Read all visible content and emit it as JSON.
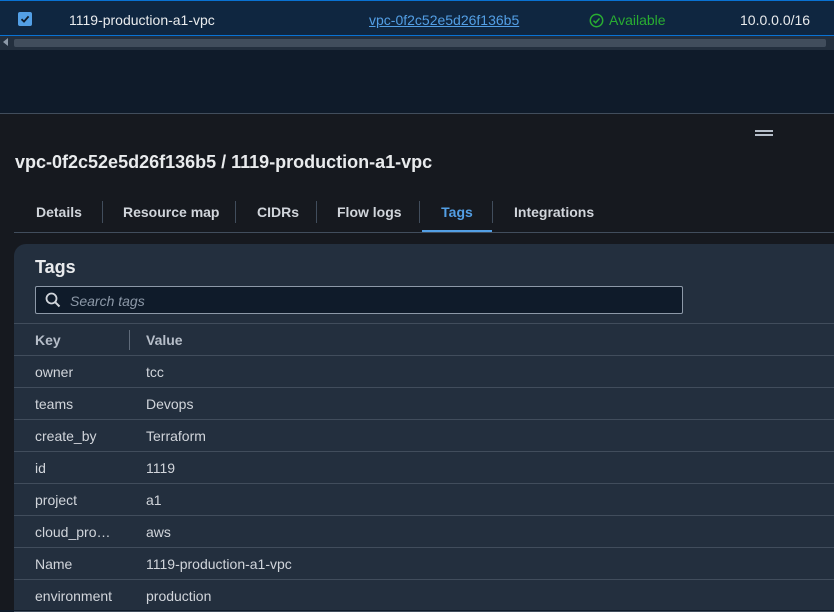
{
  "top_row": {
    "checked": true,
    "name": "1119-production-a1-vpc",
    "vpc_id": "vpc-0f2c52e5d26f136b5",
    "status": "Available",
    "cidr": "10.0.0.0/16"
  },
  "panel": {
    "title": "vpc-0f2c52e5d26f136b5 / 1119-production-a1-vpc",
    "tabs": [
      {
        "label": "Details"
      },
      {
        "label": "Resource map"
      },
      {
        "label": "CIDRs"
      },
      {
        "label": "Flow logs"
      },
      {
        "label": "Tags",
        "active": true
      },
      {
        "label": "Integrations"
      }
    ]
  },
  "tags": {
    "heading": "Tags",
    "search_placeholder": "Search tags",
    "columns": {
      "key": "Key",
      "value": "Value"
    },
    "rows": [
      {
        "key": "owner",
        "value": "tcc"
      },
      {
        "key": "teams",
        "value": "Devops"
      },
      {
        "key": "create_by",
        "value": "Terraform"
      },
      {
        "key": "id",
        "value": "1119"
      },
      {
        "key": "project",
        "value": "a1"
      },
      {
        "key": "cloud_provider",
        "value": "aws"
      },
      {
        "key": "Name",
        "value": "1119-production-a1-vpc"
      },
      {
        "key": "environment",
        "value": "production"
      }
    ]
  },
  "colors": {
    "accent": "#539fe5",
    "status_available": "#29ad32",
    "panel_bg": "#16191f",
    "container_bg": "#232f3e"
  },
  "icons": {
    "checkbox": "checkbox-checked-icon",
    "status": "check-circle-icon",
    "search": "search-icon",
    "scroll_left": "caret-left-icon",
    "drag": "drag-handle-icon"
  }
}
